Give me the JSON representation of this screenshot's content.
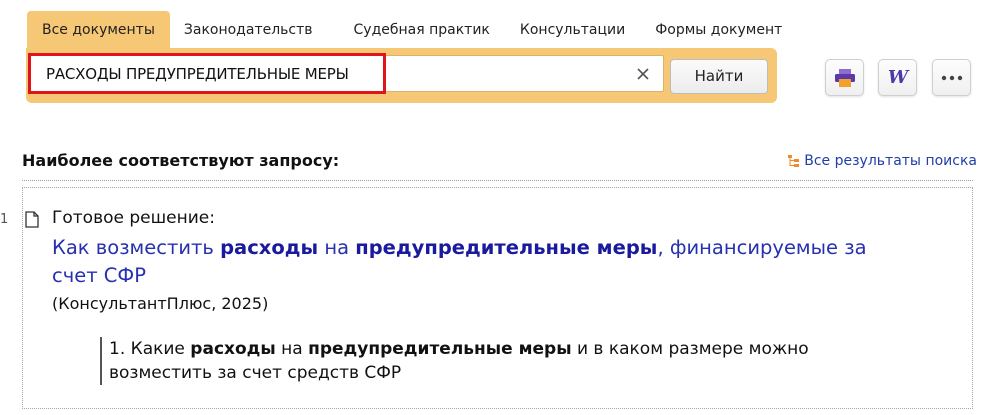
{
  "tabs": [
    {
      "label": "Все документы",
      "active": true
    },
    {
      "label": "Законодательств",
      "active": false
    },
    {
      "label": "Судебная практик",
      "active": false
    },
    {
      "label": "Консультации",
      "active": false
    },
    {
      "label": "Формы документ",
      "active": false
    }
  ],
  "search": {
    "query": "РАСХОДЫ ПРЕДУПРЕДИТЕЛЬНЫЕ МЕРЫ",
    "find_label": "Найти"
  },
  "results": {
    "title": "Наиболее соответствуют запросу:",
    "all_results_label": "Все результаты поиска",
    "items": [
      {
        "number": "1",
        "type": "Готовое решение:",
        "title_parts": [
          {
            "text": "Как возместить ",
            "bold": false
          },
          {
            "text": "расходы",
            "bold": true
          },
          {
            "text": " на ",
            "bold": false
          },
          {
            "text": "предупредительные меры",
            "bold": true
          },
          {
            "text": ", финансируемые за счет СФР",
            "bold": false
          }
        ],
        "source": "(КонсультантПлюс, 2025)",
        "snippet_parts": [
          {
            "text": "1. Какие ",
            "bold": false
          },
          {
            "text": "расходы",
            "bold": true
          },
          {
            "text": " на ",
            "bold": false
          },
          {
            "text": "предупредительные меры",
            "bold": true
          },
          {
            "text": " и в каком размере можно возместить за счет средств СФР",
            "bold": false
          }
        ]
      }
    ]
  },
  "colors": {
    "accent": "#f6c774",
    "highlight": "#e0141b",
    "link": "#2630b0"
  },
  "icons": {
    "print": "printer-icon",
    "word": "word-export-icon",
    "more": "more-icon",
    "clear": "close-icon",
    "doc": "document-icon",
    "all_results": "tree-list-icon"
  }
}
